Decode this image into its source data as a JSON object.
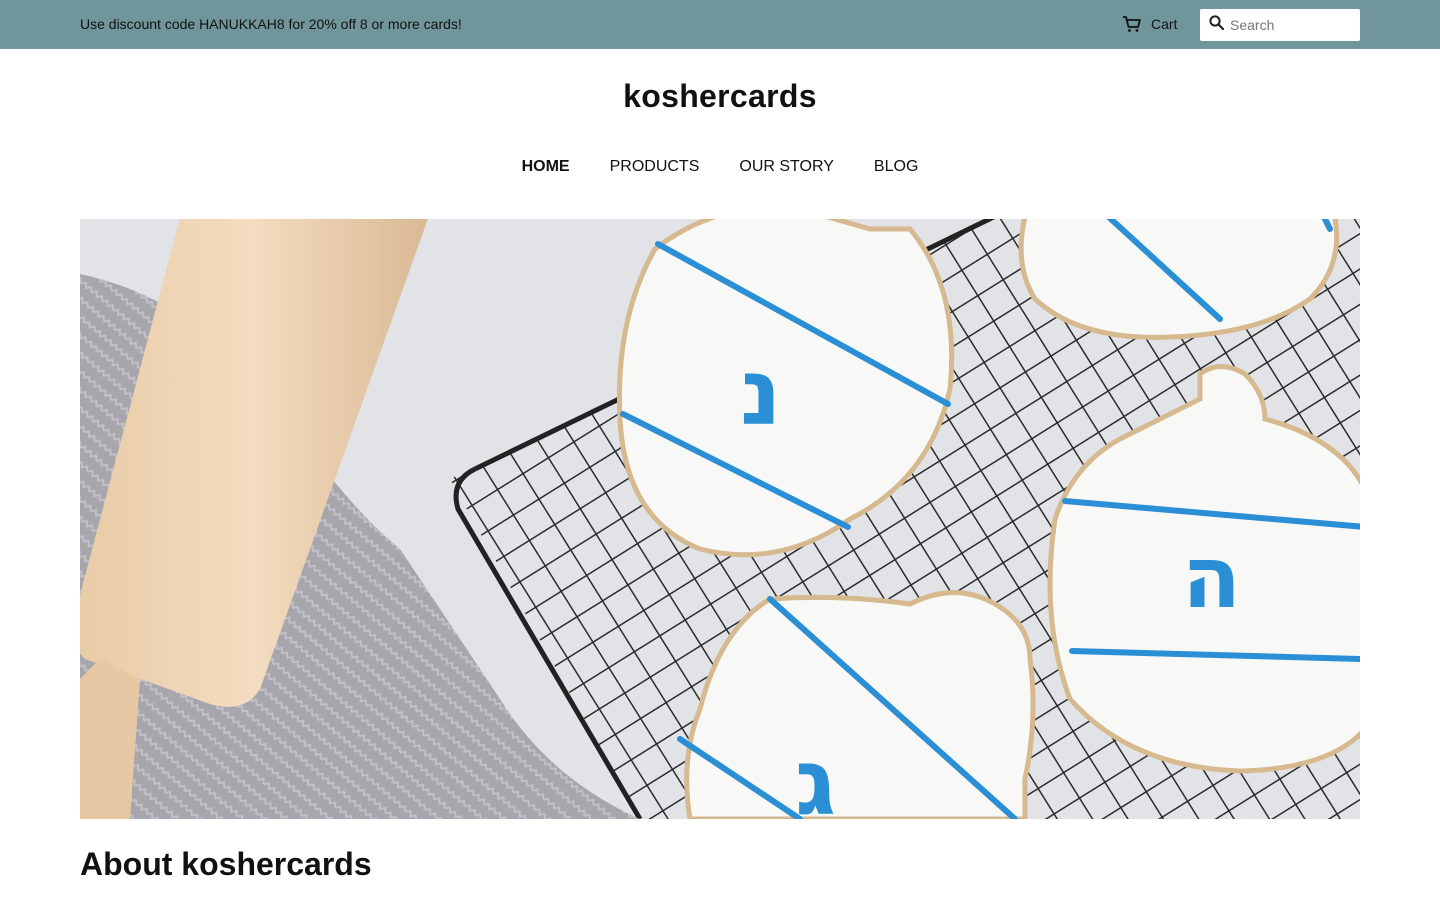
{
  "announcement": {
    "text": "Use discount code HANUKKAH8 for 20% off 8 or more cards!"
  },
  "header": {
    "cart_label": "Cart",
    "search_placeholder": "Search",
    "cart_icon": "cart-icon",
    "search_icon": "search-icon"
  },
  "site": {
    "logo": "koshercards"
  },
  "nav": {
    "items": [
      {
        "label": "HOME",
        "active": true
      },
      {
        "label": "PRODUCTS",
        "active": false
      },
      {
        "label": "OUR STORY",
        "active": false
      },
      {
        "label": "BLOG",
        "active": false
      }
    ]
  },
  "hero": {
    "letters": [
      "ג",
      "ה",
      "נ"
    ]
  },
  "about": {
    "title": "About koshercards"
  },
  "colors": {
    "announce_bar": "#70969c",
    "icing_blue": "#2a8fd4"
  }
}
